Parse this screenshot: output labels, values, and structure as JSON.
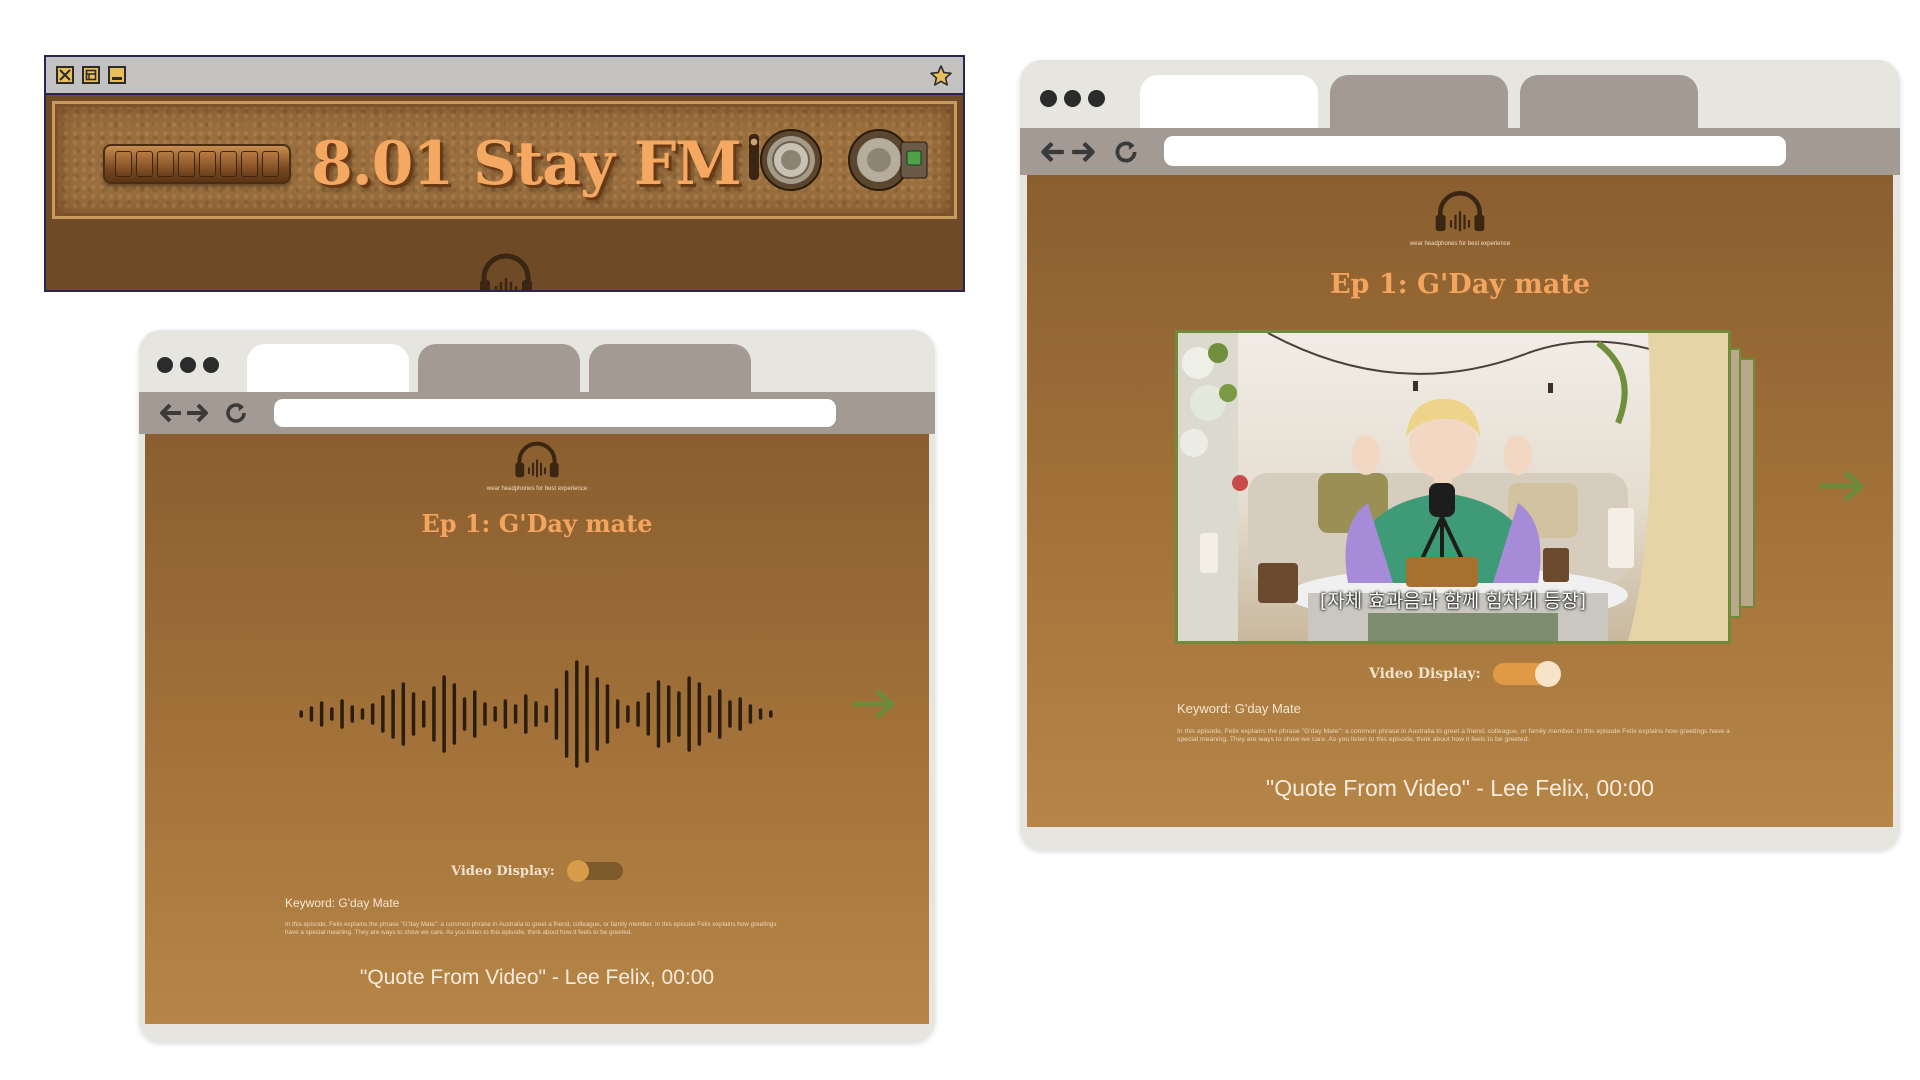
{
  "colors": {
    "brown_dark": "#6e4a26",
    "brown_mid": "#9a6e3d",
    "orange_title": "#f3a45e",
    "toggle_on": "#e09a45",
    "arrow_green": "#6e8a3a",
    "chrome_gray": "#a29a93",
    "chrome_light": "#e7e5e0"
  },
  "radio_window": {
    "title": "8.01 Stay FM",
    "controls": [
      "close-icon",
      "restore-icon",
      "minimize-icon"
    ],
    "favorite_icon": "star-icon"
  },
  "browser_audio": {
    "tagline": "wear headphones for best experience",
    "episode_title": "Ep 1: G'Day mate",
    "video_display_label": "Video Display:",
    "video_display_on": false,
    "keyword": "Keyword: G'day Mate",
    "description": "In this episode, Felix explains the phrase \"G'day Mate\": a common phrase in Australia to greet a friend, colleague, or family member. In this episode Felix explains how greetings have a special meaning. They are ways to show we care. As you listen to this episode, think about how it feels to be greeted.",
    "quote": "\"Quote From Video\" - Lee Felix, 00:00",
    "next_icon": "arrow-right-icon"
  },
  "browser_video": {
    "tagline": "wear headphones for best experience",
    "episode_title": "Ep 1: G'Day mate",
    "video_subtitle": "[자체 효과음과 함께 힘차게 등장]",
    "video_display_label": "Video Display:",
    "video_display_on": true,
    "keyword": "Keyword: G'day Mate",
    "description": "In this episode, Felix explains the phrase \"G'day Mate\": a common phrase in Australia to greet a friend, colleague, or family member. In this episode Felix explains how greetings have a special meaning. They are ways to show we care. As you listen to this episode, think about how it feels to be greeted.",
    "quote": "\"Quote From Video\" - Lee Felix, 00:00",
    "next_icon": "arrow-right-icon"
  }
}
